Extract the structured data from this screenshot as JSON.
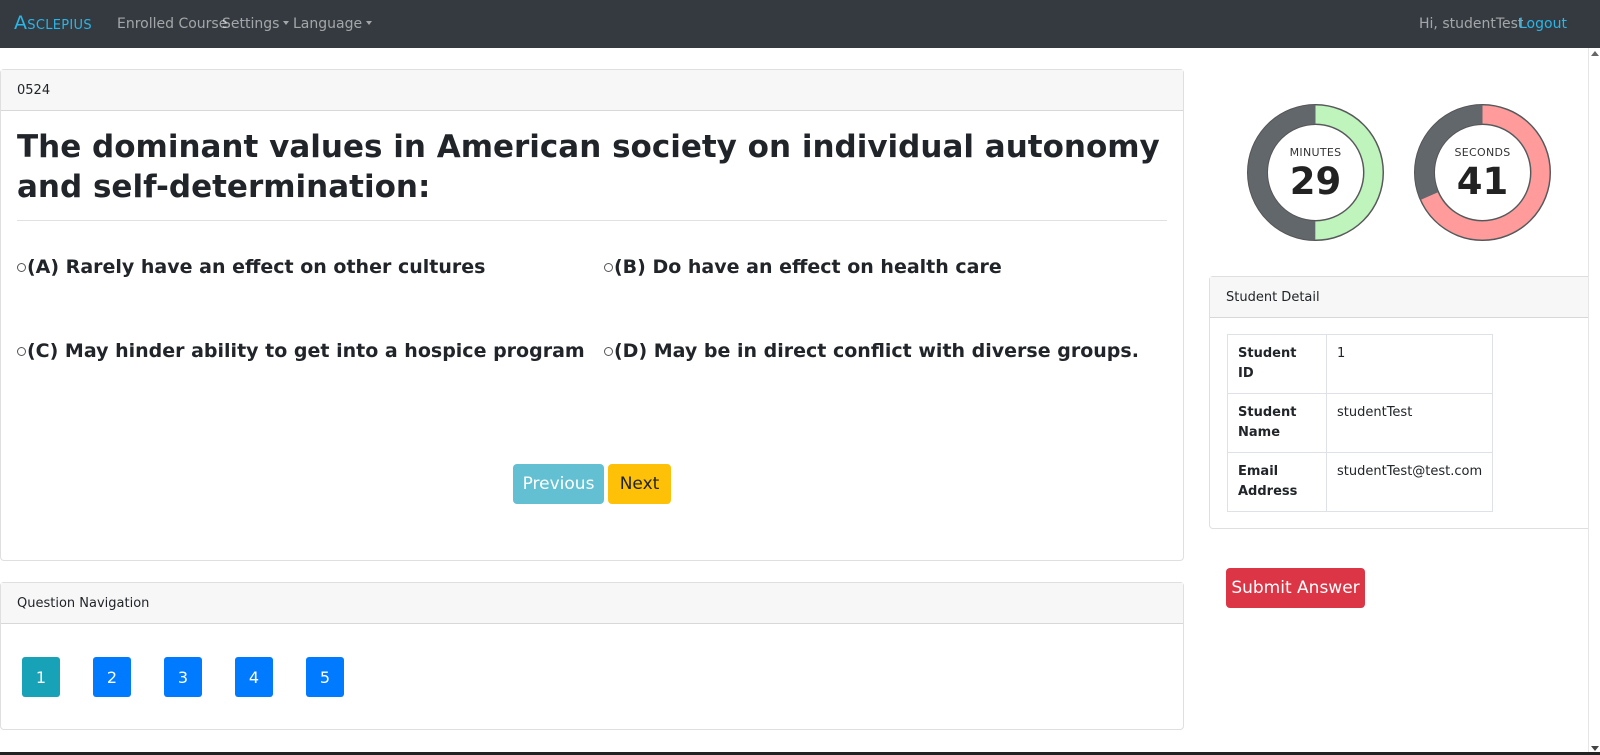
{
  "navbar": {
    "brand": "Asclepius",
    "links": {
      "enrolled": "Enrolled Course",
      "settings": "Settings",
      "language": "Language"
    },
    "greeting": "Hi, studentTest",
    "logout": "Logout"
  },
  "question": {
    "code": "0524",
    "text": "The dominant values in American society on individual autonomy and self-determination:",
    "options": [
      {
        "label": "(A)  Rarely have an effect on other cultures"
      },
      {
        "label": "(B) Do have an effect on health care"
      },
      {
        "label": "(C) May hinder ability to get into a hospice program"
      },
      {
        "label": "(D) May be in direct conflict with diverse groups."
      }
    ],
    "previous": "Previous",
    "next": "Next"
  },
  "navigation": {
    "title": "Question Navigation",
    "current": "1",
    "numbers": [
      "1",
      "2",
      "3",
      "4",
      "5"
    ],
    "colors": {
      "current": "#17a2b8",
      "other": "#007bff"
    }
  },
  "timer": {
    "minutes_label": "MINUTES",
    "minutes_value": "29",
    "minutes_fraction": 0.5,
    "minutes_color": "#bff5bd",
    "seconds_label": "SECONDS",
    "seconds_value": "41",
    "seconds_fraction": 0.683,
    "seconds_color": "#ff9b9b",
    "track_color": "#62676c"
  },
  "student": {
    "title": "Student Detail",
    "rows": [
      {
        "label": "Student ID",
        "value": "1"
      },
      {
        "label": "Student Name",
        "value": "studentTest"
      },
      {
        "label": "Email Address",
        "value": "studentTest@test.com"
      }
    ]
  },
  "submit": "Submit Answer"
}
